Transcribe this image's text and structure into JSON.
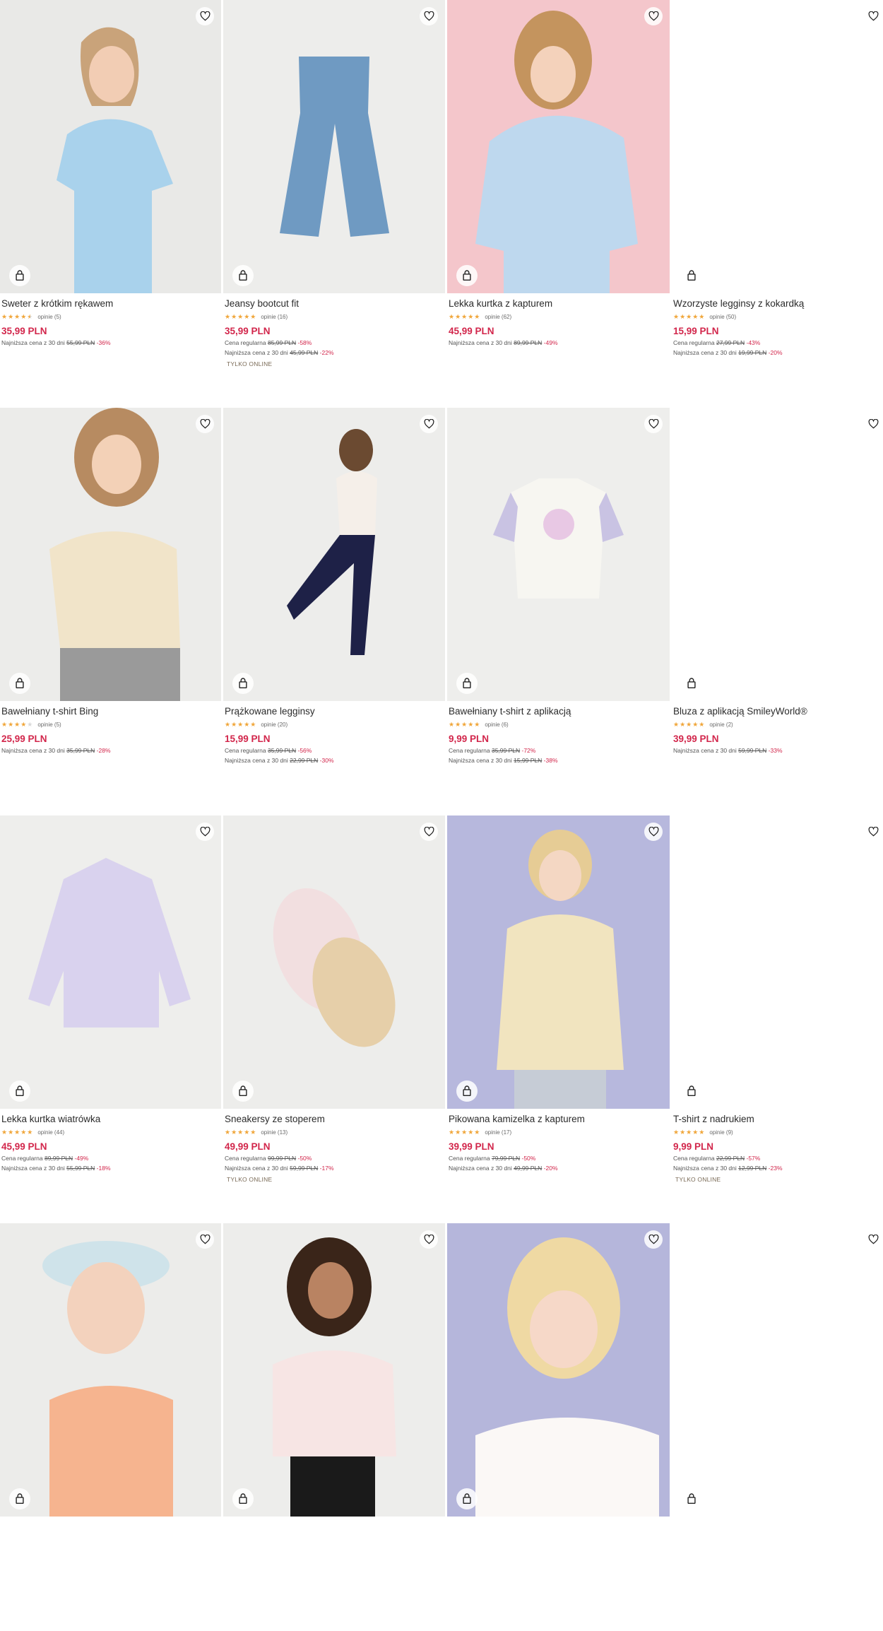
{
  "products": [
    {
      "name": "Sweter z krótkim rękawem",
      "stars": 4.5,
      "reviews": "opinie (5)",
      "price": "35,99 PLN",
      "lines": [
        {
          "label": "Najniższa cena z 30 dni",
          "old": "55,99 PLN",
          "disc": "-36%"
        }
      ],
      "tag": "",
      "visual": "girl-blue-sweater"
    },
    {
      "name": "Jeansy bootcut fit",
      "stars": 5,
      "reviews": "opinie (16)",
      "price": "35,99 PLN",
      "lines": [
        {
          "label": "Cena regularna",
          "old": "85,99 PLN",
          "disc": "-58%"
        },
        {
          "label": "Najniższa cena z 30 dni",
          "old": "45,99 PLN",
          "disc": "-22%"
        }
      ],
      "tag": "TYLKO ONLINE",
      "visual": "jeans"
    },
    {
      "name": "Lekka kurtka z kapturem",
      "stars": 5,
      "reviews": "opinie (62)",
      "price": "45,99 PLN",
      "lines": [
        {
          "label": "Najniższa cena z 30 dni",
          "old": "89,99 PLN",
          "disc": "-49%"
        }
      ],
      "tag": "",
      "visual": "girl-blue-jacket"
    },
    {
      "name": "Wzorzyste legginsy z kokardką",
      "stars": 5,
      "reviews": "opinie (50)",
      "price": "15,99 PLN",
      "lines": [
        {
          "label": "Cena regularna",
          "old": "27,99 PLN",
          "disc": "-43%"
        },
        {
          "label": "Najniższa cena z 30 dni",
          "old": "19,99 PLN",
          "disc": "-20%"
        }
      ],
      "tag": "",
      "visual": "blank"
    },
    {
      "name": "Bawełniany t-shirt Bing",
      "stars": 4,
      "reviews": "opinie (5)",
      "price": "25,99 PLN",
      "lines": [
        {
          "label": "Najniższa cena z 30 dni",
          "old": "35,99 PLN",
          "disc": "-28%"
        }
      ],
      "tag": "",
      "visual": "girl-bing-tee"
    },
    {
      "name": "Prążkowane legginsy",
      "stars": 5,
      "reviews": "opinie (20)",
      "price": "15,99 PLN",
      "lines": [
        {
          "label": "Cena regularna",
          "old": "35,99 PLN",
          "disc": "-56%"
        },
        {
          "label": "Najniższa cena z 30 dni",
          "old": "22,99 PLN",
          "disc": "-30%"
        }
      ],
      "tag": "",
      "visual": "girl-leggings"
    },
    {
      "name": "Bawełniany t-shirt z aplikacją",
      "stars": 5,
      "reviews": "opinie (6)",
      "price": "9,99 PLN",
      "lines": [
        {
          "label": "Cena regularna",
          "old": "35,99 PLN",
          "disc": "-72%"
        },
        {
          "label": "Najniższa cena z 30 dni",
          "old": "15,99 PLN",
          "disc": "-38%"
        }
      ],
      "tag": "",
      "visual": "tshirt-flowers"
    },
    {
      "name": "Bluza z aplikacją SmileyWorld®",
      "stars": 5,
      "reviews": "opinie (2)",
      "price": "39,99 PLN",
      "lines": [
        {
          "label": "Najniższa cena z 30 dni",
          "old": "59,99 PLN",
          "disc": "-33%"
        }
      ],
      "tag": "",
      "visual": "blank"
    },
    {
      "name": "Lekka kurtka wiatrówka",
      "stars": 5,
      "reviews": "opinie (44)",
      "price": "45,99 PLN",
      "lines": [
        {
          "label": "Cena regularna",
          "old": "89,99 PLN",
          "disc": "-49%"
        },
        {
          "label": "Najniższa cena z 30 dni",
          "old": "55,99 PLN",
          "disc": "-18%"
        }
      ],
      "tag": "",
      "visual": "lilac-jacket"
    },
    {
      "name": "Sneakersy ze stoperem",
      "stars": 5,
      "reviews": "opinie (13)",
      "price": "49,99 PLN",
      "lines": [
        {
          "label": "Cena regularna",
          "old": "99,99 PLN",
          "disc": "-50%"
        },
        {
          "label": "Najniższa cena z 30 dni",
          "old": "59,99 PLN",
          "disc": "-17%"
        }
      ],
      "tag": "TYLKO ONLINE",
      "visual": "sneakers"
    },
    {
      "name": "Pikowana kamizelka z kapturem",
      "stars": 5,
      "reviews": "opinie (17)",
      "price": "39,99 PLN",
      "lines": [
        {
          "label": "Cena regularna",
          "old": "79,99 PLN",
          "disc": "-50%"
        },
        {
          "label": "Najniższa cena z 30 dni",
          "old": "49,99 PLN",
          "disc": "-20%"
        }
      ],
      "tag": "",
      "visual": "girl-vest"
    },
    {
      "name": "T-shirt z nadrukiem",
      "stars": 5,
      "reviews": "opinie (9)",
      "price": "9,99 PLN",
      "lines": [
        {
          "label": "Cena regularna",
          "old": "22,99 PLN",
          "disc": "-57%"
        },
        {
          "label": "Najniższa cena z 30 dni",
          "old": "12,99 PLN",
          "disc": "-23%"
        }
      ],
      "tag": "TYLKO ONLINE",
      "visual": "blank"
    },
    {
      "name": "",
      "stars": 0,
      "reviews": "",
      "price": "",
      "lines": [],
      "tag": "",
      "visual": "girl-cap"
    },
    {
      "name": "",
      "stars": 0,
      "reviews": "",
      "price": "",
      "lines": [],
      "tag": "",
      "visual": "girl-bing-sweat"
    },
    {
      "name": "",
      "stars": 0,
      "reviews": "",
      "price": "",
      "lines": [],
      "tag": "",
      "visual": "girl-white-tee"
    },
    {
      "name": "",
      "stars": 0,
      "reviews": "",
      "price": "",
      "lines": [],
      "tag": "",
      "visual": "blank"
    }
  ],
  "colors": {
    "price": "#d2264b",
    "stars": "#f0a63a",
    "placeholder": "#ececec"
  },
  "icons": {
    "favorite": "heart-icon",
    "cart": "shopping-bag-icon"
  }
}
